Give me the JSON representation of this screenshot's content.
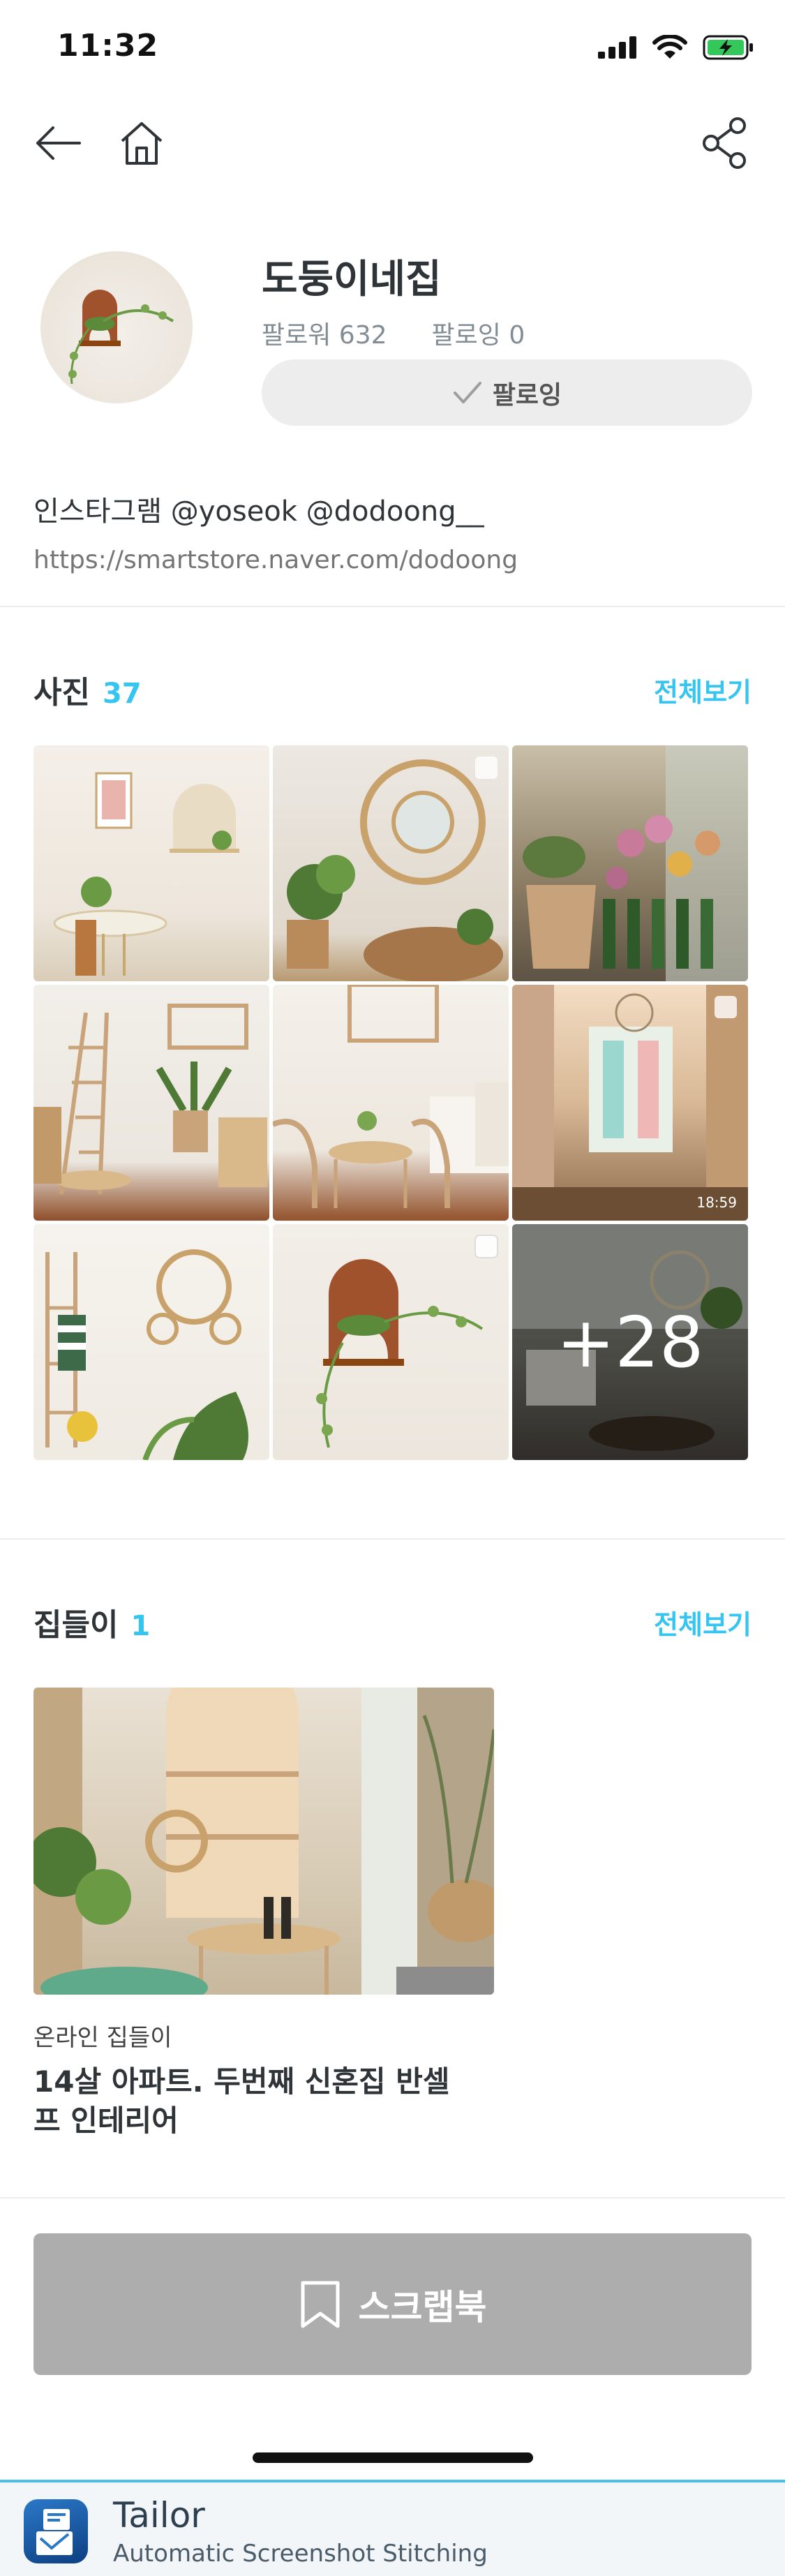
{
  "status_bar": {
    "time": "11:32"
  },
  "profile": {
    "name": "도둥이네집",
    "followers": "팔로워 632",
    "following": "팔로잉 0",
    "follow_button_label": "팔로잉",
    "bio": "인스타그램 @yoseok @dodoong__",
    "link": "https://smartstore.naver.com/dodoong"
  },
  "photos_section": {
    "title": "사진",
    "count": "37",
    "see_all": "전체보기",
    "video_duration": "18:59",
    "more_count": "+28"
  },
  "house_section": {
    "title": "집들이",
    "count": "1",
    "see_all": "전체보기",
    "card": {
      "category": "온라인 집들이",
      "title": "14살 아파트. 두번째 신혼집 반셀프 인테리어"
    }
  },
  "scrapbook": {
    "label": "스크랩북"
  },
  "banner": {
    "title": "Tailor",
    "subtitle": "Automatic Screenshot Stitching"
  },
  "colors": {
    "accent": "#35c5f0",
    "text": "#2f3438",
    "muted": "#828c94",
    "scrap_button": "#adadad"
  }
}
